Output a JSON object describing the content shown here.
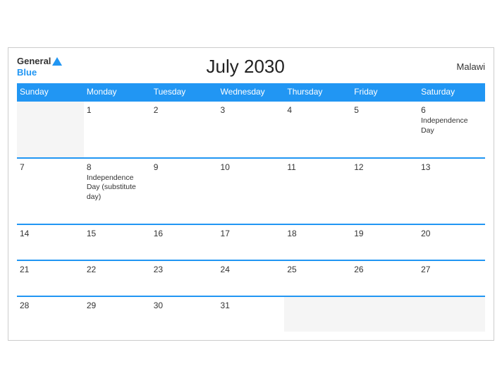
{
  "header": {
    "logo_general": "General",
    "logo_blue": "Blue",
    "title": "July 2030",
    "country": "Malawi"
  },
  "days_of_week": [
    "Sunday",
    "Monday",
    "Tuesday",
    "Wednesday",
    "Thursday",
    "Friday",
    "Saturday"
  ],
  "weeks": [
    [
      {
        "day": "",
        "empty": true
      },
      {
        "day": "1",
        "event": ""
      },
      {
        "day": "2",
        "event": ""
      },
      {
        "day": "3",
        "event": ""
      },
      {
        "day": "4",
        "event": ""
      },
      {
        "day": "5",
        "event": ""
      },
      {
        "day": "6",
        "event": "Independence Day"
      }
    ],
    [
      {
        "day": "7",
        "event": ""
      },
      {
        "day": "8",
        "event": "Independence Day\n(substitute day)"
      },
      {
        "day": "9",
        "event": ""
      },
      {
        "day": "10",
        "event": ""
      },
      {
        "day": "11",
        "event": ""
      },
      {
        "day": "12",
        "event": ""
      },
      {
        "day": "13",
        "event": ""
      }
    ],
    [
      {
        "day": "14",
        "event": ""
      },
      {
        "day": "15",
        "event": ""
      },
      {
        "day": "16",
        "event": ""
      },
      {
        "day": "17",
        "event": ""
      },
      {
        "day": "18",
        "event": ""
      },
      {
        "day": "19",
        "event": ""
      },
      {
        "day": "20",
        "event": ""
      }
    ],
    [
      {
        "day": "21",
        "event": ""
      },
      {
        "day": "22",
        "event": ""
      },
      {
        "day": "23",
        "event": ""
      },
      {
        "day": "24",
        "event": ""
      },
      {
        "day": "25",
        "event": ""
      },
      {
        "day": "26",
        "event": ""
      },
      {
        "day": "27",
        "event": ""
      }
    ],
    [
      {
        "day": "28",
        "event": ""
      },
      {
        "day": "29",
        "event": ""
      },
      {
        "day": "30",
        "event": ""
      },
      {
        "day": "31",
        "event": ""
      },
      {
        "day": "",
        "empty": true
      },
      {
        "day": "",
        "empty": true
      },
      {
        "day": "",
        "empty": true
      }
    ]
  ]
}
